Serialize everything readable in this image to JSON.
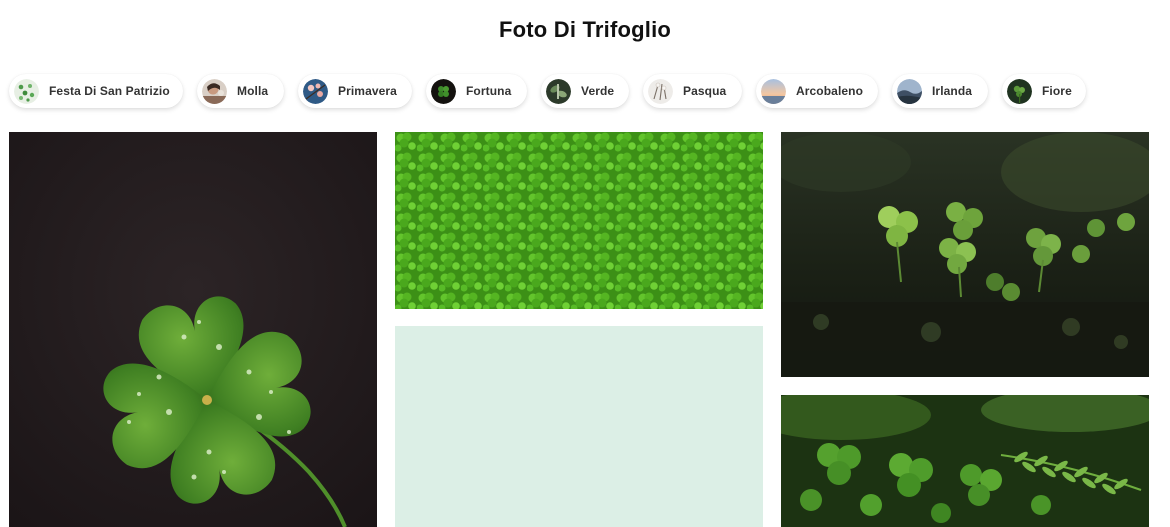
{
  "page": {
    "title": "Foto Di Trifoglio"
  },
  "categories": [
    {
      "label": "Festa Di San Patrizio",
      "icon": "shamrock-pattern-thumbnail"
    },
    {
      "label": "Molla",
      "icon": "portrait-thumbnail"
    },
    {
      "label": "Primavera",
      "icon": "blossom-sky-thumbnail"
    },
    {
      "label": "Fortuna",
      "icon": "clover-dark-thumbnail"
    },
    {
      "label": "Verde",
      "icon": "leaves-thumbnail"
    },
    {
      "label": "Pasqua",
      "icon": "easter-flowers-thumbnail"
    },
    {
      "label": "Arcobaleno",
      "icon": "sunset-sky-thumbnail"
    },
    {
      "label": "Irlanda",
      "icon": "irish-landscape-thumbnail"
    },
    {
      "label": "Fiore",
      "icon": "flower-thumbnail"
    }
  ],
  "photos": [
    {
      "subject": "four-leaf-clover-with-dew",
      "colors": [
        "#221b1d",
        "#4a8a26"
      ]
    },
    {
      "subject": "clover-field-top-view",
      "colors": [
        "#3f9a18",
        "#5cc42a"
      ]
    },
    {
      "subject": "clover-in-forest-dark",
      "colors": [
        "#1d2419",
        "#86b84a"
      ]
    },
    {
      "subject": "mint-green-paper-background",
      "colors": [
        "#dcefe6"
      ]
    },
    {
      "subject": "clovers-and-fern",
      "colors": [
        "#1f3a14",
        "#4f9b2c"
      ]
    }
  ]
}
